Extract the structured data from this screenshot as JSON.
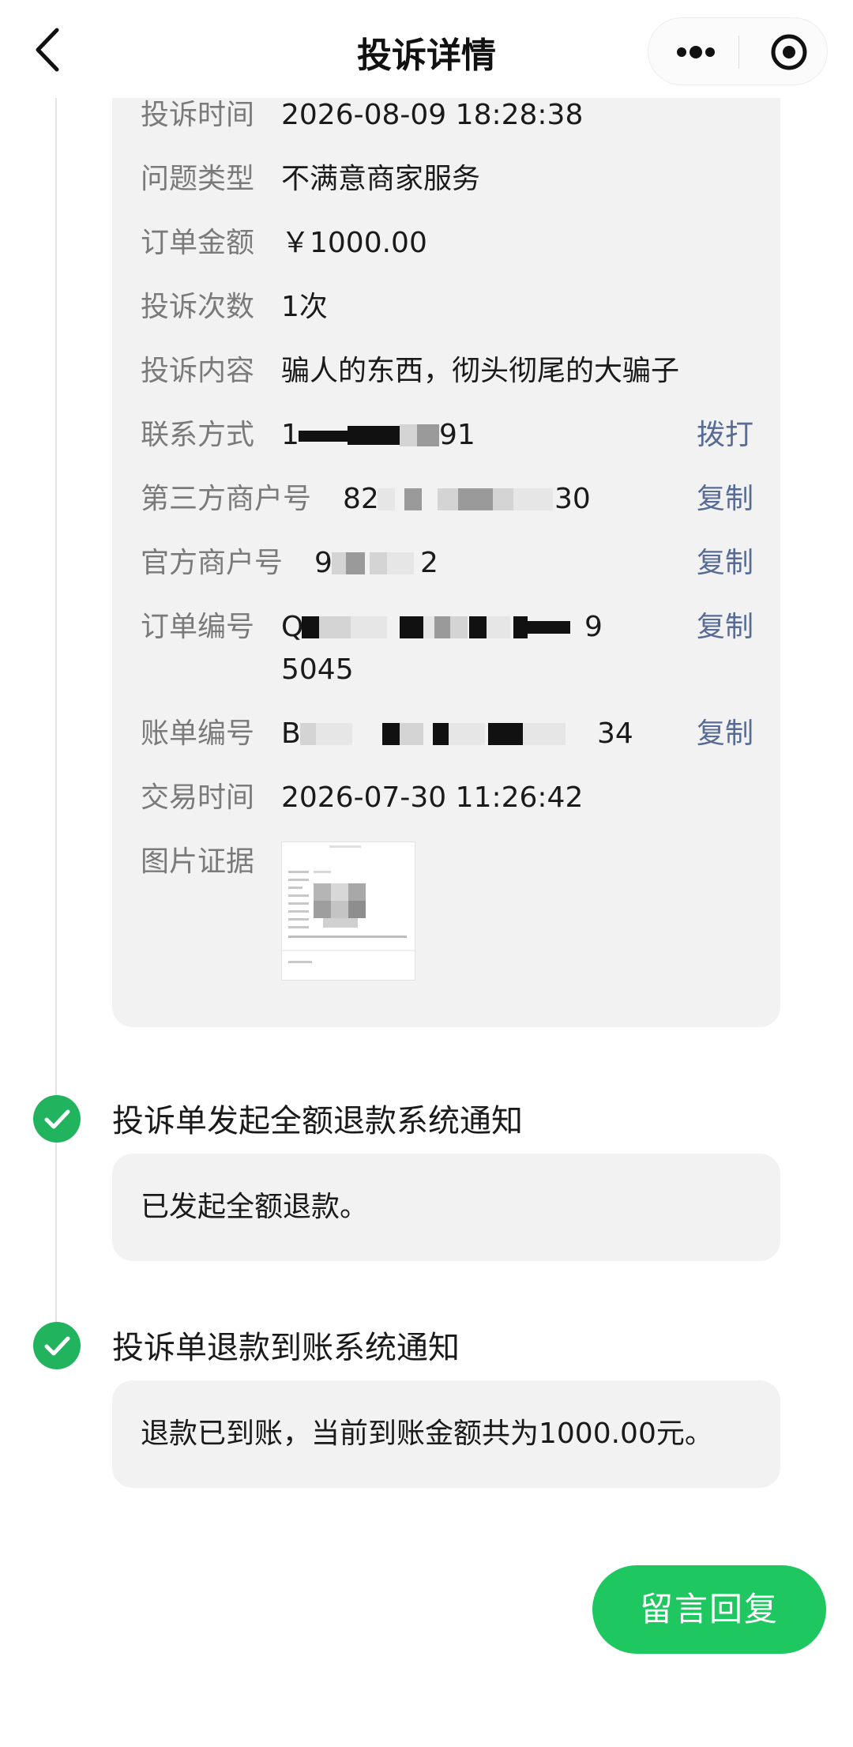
{
  "header": {
    "title": "投诉详情",
    "back_icon": "chevron-left-icon",
    "more_icon": "more-dots-icon",
    "close_icon": "target-close-icon"
  },
  "details": {
    "complaint_time": {
      "label": "投诉时间",
      "value": "2026-08-09 18:28:38"
    },
    "issue_type": {
      "label": "问题类型",
      "value": "不满意商家服务"
    },
    "order_amount": {
      "label": "订单金额",
      "value": "￥1000.00"
    },
    "complaint_count": {
      "label": "投诉次数",
      "value": "1次"
    },
    "complaint_content": {
      "label": "投诉内容",
      "value": "骗人的东西，彻头彻尾的大骗子"
    },
    "contact": {
      "label": "联系方式",
      "value_start": "1",
      "value_end": "91",
      "action": "拨打"
    },
    "third_party_merchant": {
      "label": "第三方商户号",
      "value_start": "82",
      "value_end": "30",
      "action": "复制"
    },
    "official_merchant": {
      "label": "官方商户号",
      "value_start": "9",
      "value_end": "2",
      "action": "复制"
    },
    "order_number": {
      "label": "订单编号",
      "value_start": "Q",
      "value_end": "9",
      "value_line2": "5045",
      "action": "复制"
    },
    "bill_number": {
      "label": "账单编号",
      "value_start": "B",
      "value_end": "34",
      "action": "复制"
    },
    "transaction_time": {
      "label": "交易时间",
      "value": "2026-07-30 11:26:42"
    },
    "evidence": {
      "label": "图片证据"
    }
  },
  "timeline": [
    {
      "title": "投诉单发起全额退款系统通知",
      "message": "已发起全额退款。",
      "icon": "check-circle-icon"
    },
    {
      "title": "投诉单退款到账系统通知",
      "message": "退款已到账，当前到账金额共为1000.00元。",
      "icon": "check-circle-icon"
    }
  ],
  "reply_button": {
    "label": "留言回复"
  },
  "colors": {
    "accent_green": "#1fc760",
    "link_blue": "#576b95",
    "card_bg": "#f2f2f2",
    "label_grey": "#7a7a7a"
  }
}
